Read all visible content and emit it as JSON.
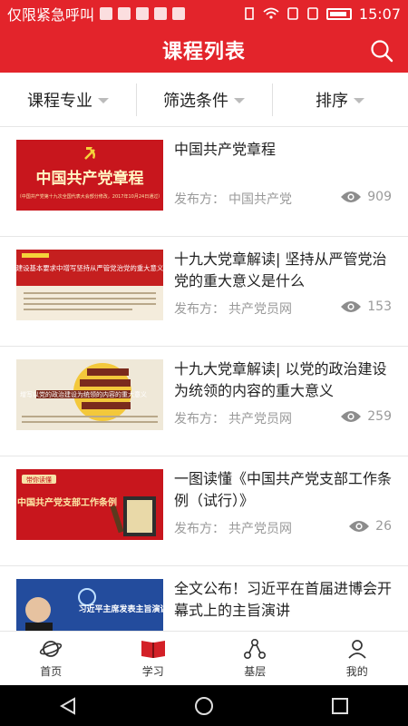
{
  "status_bar": {
    "carrier": "仅限紧急呼叫",
    "time": "15:07"
  },
  "app_bar": {
    "title": "课程列表",
    "search_icon": "search-icon"
  },
  "filters": [
    {
      "label": "课程专业"
    },
    {
      "label": "筛选条件"
    },
    {
      "label": "排序"
    }
  ],
  "publisher_prefix": "发布方：",
  "items": [
    {
      "title": "中国共产党章程",
      "publisher": "中国共产党",
      "views": "909",
      "thumb_text": "中国共产党章程",
      "thumb_caption": "（中国共产党第十九次全国代表大会部分修改，2017年10月24日通过）"
    },
    {
      "title": "十九大党章解读| 坚持从严管党治党的重大意义是什么",
      "publisher": "共产党员网",
      "views": "153",
      "thumb_text": "在党的建设基本要求中增写坚持从严管党治党的重大意义是什么"
    },
    {
      "title": "十九大党章解读| 以党的政治建设为统领的内容的重大意义",
      "publisher": "共产党员网",
      "views": "259",
      "thumb_text": "增写以党的政治建设为统领的内容的重大意义"
    },
    {
      "title": "一图读懂《中国共产党支部工作条例（试行）》",
      "publisher": "共产党员网",
      "views": "26",
      "thumb_text": "中国共产党支部工作条例",
      "thumb_tag": "带你读懂"
    },
    {
      "title": "全文公布！习近平在首届进博会开幕式上的主旨演讲",
      "publisher": "",
      "views": "",
      "thumb_text": "习近平主席发表主旨演讲"
    }
  ],
  "tabs": [
    {
      "label": "首页",
      "icon": "planet-icon"
    },
    {
      "label": "学习",
      "icon": "book-icon"
    },
    {
      "label": "基层",
      "icon": "org-tree-icon"
    },
    {
      "label": "我的",
      "icon": "user-icon"
    }
  ],
  "colors": {
    "brand": "#e3242b"
  }
}
